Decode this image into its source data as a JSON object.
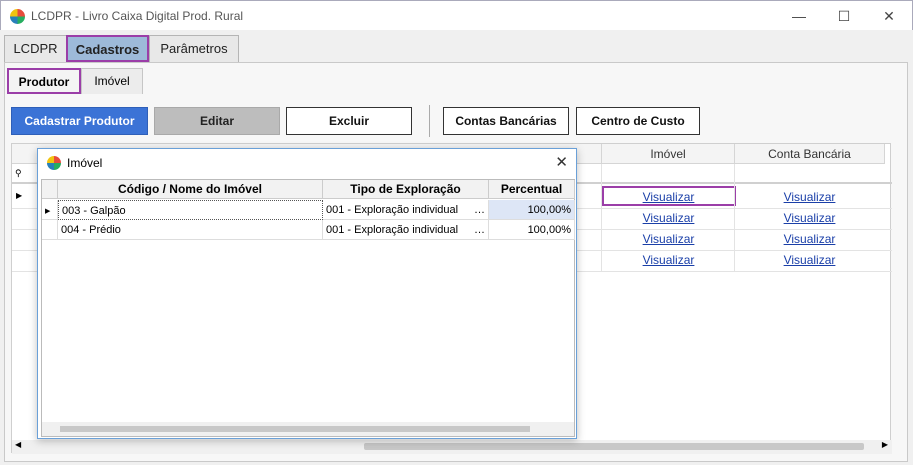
{
  "window": {
    "title": "LCDPR - Livro Caixa Digital Prod. Rural",
    "minimize_icon": "minimize-icon",
    "maximize_icon": "maximize-icon",
    "close_icon": "close-icon"
  },
  "tabs": [
    {
      "label": "LCDPR"
    },
    {
      "label": "Cadastros"
    },
    {
      "label": "Parâmetros"
    }
  ],
  "subtabs": [
    {
      "label": "Produtor"
    },
    {
      "label": "Imóvel"
    }
  ],
  "toolbar": {
    "cadastrar": "Cadastrar Produtor",
    "editar": "Editar",
    "excluir": "Excluir",
    "contas": "Contas Bancárias",
    "centro": "Centro de Custo"
  },
  "main_grid": {
    "columns": [
      {
        "label": "Imóvel"
      },
      {
        "label": "Conta Bancária"
      }
    ],
    "rows": [
      {
        "imovel": "Visualizar",
        "conta": "Visualizar"
      },
      {
        "imovel": "Visualizar",
        "conta": "Visualizar"
      },
      {
        "imovel": "Visualizar",
        "conta": "Visualizar"
      },
      {
        "imovel": "Visualizar",
        "conta": "Visualizar"
      }
    ]
  },
  "dialog": {
    "title": "Imóvel",
    "columns": [
      {
        "label": "Código / Nome do Imóvel"
      },
      {
        "label": "Tipo de Exploração"
      },
      {
        "label": "Percentual"
      }
    ],
    "rows": [
      {
        "codigo": "003 - Galpão",
        "tipo": "001 - Exploração individual",
        "percentual": "100,00%"
      },
      {
        "codigo": "004 - Prédio",
        "tipo": "001 - Exploração individual",
        "percentual": "100,00%"
      }
    ]
  }
}
